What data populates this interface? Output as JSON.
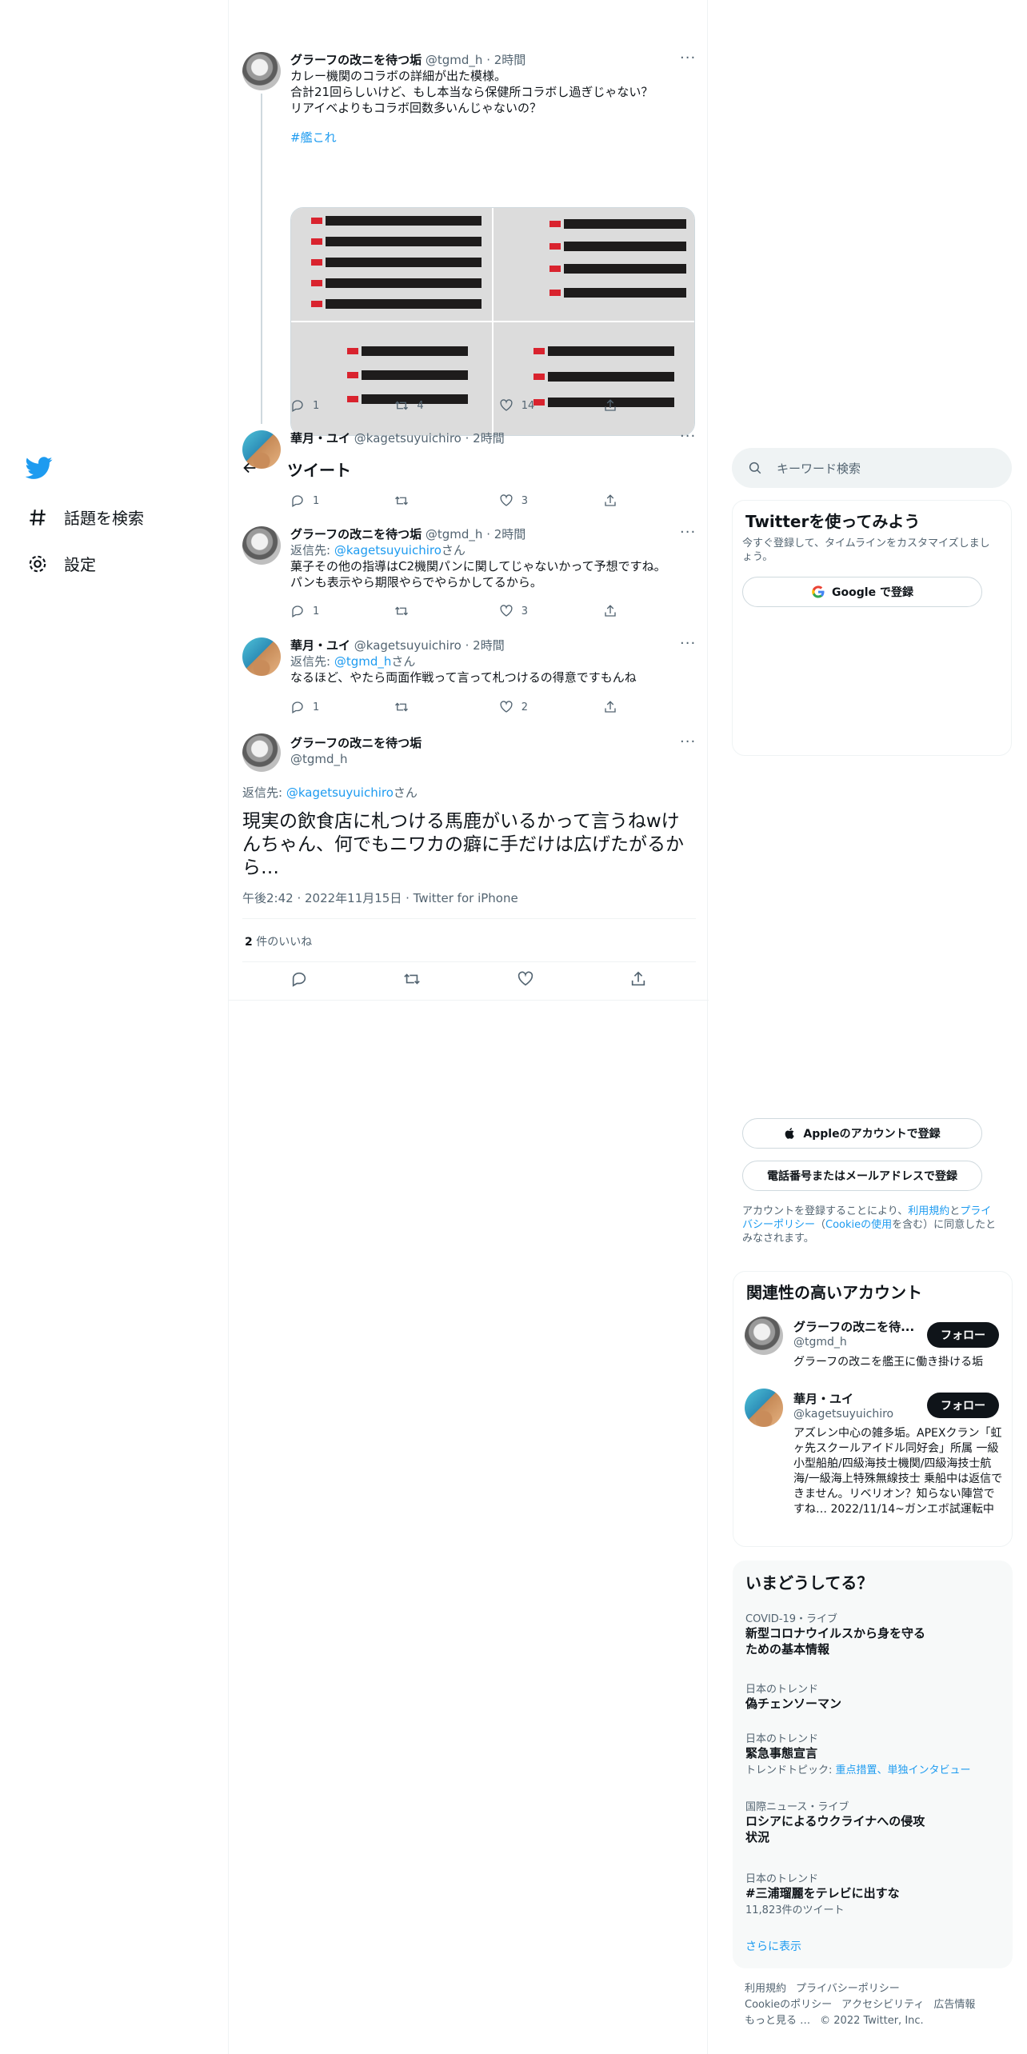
{
  "nav": {
    "items": [
      {
        "label": "話題を検索",
        "icon": "hashtag-icon"
      },
      {
        "label": "設定",
        "icon": "gear-icon"
      }
    ]
  },
  "header": {
    "title": "ツイート"
  },
  "tweets": [
    {
      "name": "グラーフの改ニを待つ垢",
      "handle": "@tgmd_h",
      "time": "2時間",
      "text": "カレー機関のコラボの詳細が出た模様。\n合計21回らしいけど、もし本当なら保健所コラボし過ぎじゃない？\nリアイベよりもコラボ回数多いんじゃないの？",
      "hashtag": "#艦これ",
      "reply_count": "1",
      "retweet_count": "4",
      "like_count": "14"
    },
    {
      "name": "華月・ユイ",
      "handle": "@kagetsuyuichiro",
      "time": "2時間",
      "reply_count": "1",
      "retweet_count": "",
      "like_count": "3"
    },
    {
      "name": "グラーフの改ニを待つ垢",
      "handle": "@tgmd_h",
      "time": "2時間",
      "reply_prefix": "返信先: ",
      "reply_to": "@kagetsuyuichiro",
      "reply_suffix": "さん",
      "text": "菓子その他の指導はC2機関パンに関してじゃないかって予想ですね。\nパンも表示やら期限やらでやらかしてるから。",
      "reply_count": "1",
      "retweet_count": "",
      "like_count": "3"
    },
    {
      "name": "華月・ユイ",
      "handle": "@kagetsuyuichiro",
      "time": "2時間",
      "reply_prefix": "返信先: ",
      "reply_to": "@tgmd_h",
      "reply_suffix": "さん",
      "text": "なるほど、やたら両面作戦って言って札つけるの得意ですもんね",
      "reply_count": "1",
      "retweet_count": "",
      "like_count": "2"
    }
  ],
  "focus": {
    "name": "グラーフの改ニを待つ垢",
    "handle": "@tgmd_h",
    "reply_prefix": "返信先: ",
    "reply_to": "@kagetsuyuichiro",
    "reply_suffix": "さん",
    "text": "現実の飲食店に札つける馬鹿がいるかって言うねwけんちゃん、何でもニワカの癖に手だけは広げたがるから…",
    "meta": "午後2:42 · 2022年11月15日 · Twitter for iPhone",
    "likes_number": "2",
    "likes_label": " 件のいいね"
  },
  "search": {
    "placeholder": "キーワード検索"
  },
  "signup": {
    "title": "Twitterを使ってみよう",
    "subtitle": "今すぐ登録して、タイムラインをカスタマイズしましょう。",
    "google": "Google で登録",
    "apple": "Appleのアカウントで登録",
    "phone": "電話番号またはメールアドレスで登録",
    "legal_1": "アカウントを登録することにより、",
    "legal_terms": "利用規約",
    "legal_2": "と",
    "legal_privacy": "プライバシーポリシー",
    "legal_3": "（",
    "legal_cookie": "Cookieの使用",
    "legal_4": "を含む）に同意したとみなされます。"
  },
  "related": {
    "title": "関連性の高いアカウント",
    "follow_label": "フォロー",
    "accounts": [
      {
        "name": "グラーフの改ニを待...",
        "handle": "@tgmd_h",
        "bio": "グラーフの改ニを艦王に働き掛ける垢"
      },
      {
        "name": "華月・ユイ",
        "handle": "@kagetsuyuichiro",
        "bio": "アズレン中心の雑多垢。APEXクラン「虹ヶ先スクールアイドル同好会」所属 一級小型船舶/四級海技士機関/四級海技士航海/一級海上特殊無線技士 乗船中は返信できません。リベリオン？知らない陣営ですね… 2022/11/14~ガンエボ試運転中"
      }
    ]
  },
  "trends": {
    "title": "いまどうしてる？",
    "items": [
      {
        "category": "COVID-19・ライブ",
        "title": "新型コロナウイルスから身を守るための基本情報"
      },
      {
        "category": "日本のトレンド",
        "title": "偽チェンソーマン"
      },
      {
        "category": "日本のトレンド",
        "title": "緊急事態宣言",
        "sub_prefix": "トレンドトピック: ",
        "sub_links": "重点措置、単独インタビュー"
      },
      {
        "category": "国際ニュース・ライブ",
        "title": "ロシアによるウクライナへの侵攻状況"
      },
      {
        "category": "日本のトレンド",
        "title": "#三浦瑠麗をテレビに出すな",
        "sub": "11,823件のツイート"
      }
    ],
    "show_more": "さらに表示"
  },
  "footer": {
    "links": [
      "利用規約",
      "プライバシーポリシー",
      "Cookieのポリシー",
      "アクセシビリティ",
      "広告情報",
      "もっと見る …"
    ],
    "copyright": "© 2022 Twitter, Inc."
  }
}
